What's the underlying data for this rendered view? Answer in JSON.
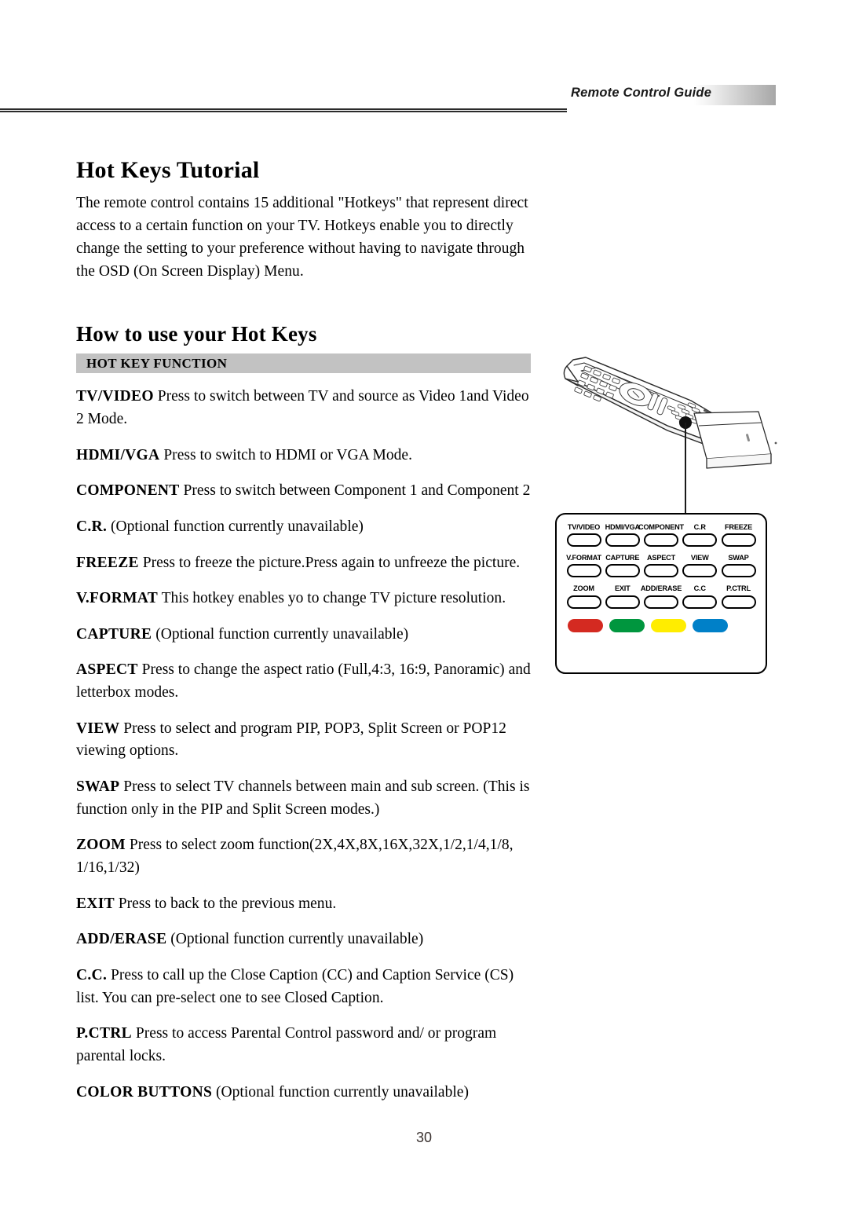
{
  "header": {
    "running_title": "Remote Control Guide"
  },
  "section_one": {
    "title": "Hot Keys Tutorial",
    "intro": "The remote control contains 15 additional \"Hotkeys\" that represent direct access to a certain function on your TV.  Hotkeys enable you to directly change the setting to your preference without having to navigate through the OSD (On Screen Display) Menu."
  },
  "section_two": {
    "title": "How to use your Hot Keys",
    "table_header": "HOT KEY FUNCTION",
    "entries": [
      {
        "key": "TV/VIDEO",
        "desc": "Press to switch between TV and  source as Video 1and Video 2 Mode."
      },
      {
        "key": "HDMI/VGA",
        "desc": "Press to switch to HDMI or VGA Mode."
      },
      {
        "key": "COMPONENT",
        "desc": "Press to switch between Component 1 and Component 2"
      },
      {
        "key": "C.R.",
        "desc": "(Optional function currently unavailable)"
      },
      {
        "key": "FREEZE",
        "desc": "Press to freeze the picture.Press again to unfreeze the  picture."
      },
      {
        "key": "V.FORMAT",
        "desc": "This hotkey enables yo to change TV picture resolution."
      },
      {
        "key": "CAPTURE",
        "desc": "(Optional function currently unavailable)"
      },
      {
        "key": "ASPECT",
        "desc": "Press to change the aspect ratio (Full,4:3, 16:9, Panoramic) and letterbox modes."
      },
      {
        "key": "VIEW",
        "desc": "Press to select and program PIP, POP3, Split Screen or POP12 viewing options."
      },
      {
        "key": "SWAP",
        "desc": "Press to select TV channels between main and sub screen. (This is function only in the PIP and Split Screen modes.)"
      },
      {
        "key": "ZOOM",
        "desc": "Press to select zoom function(2X,4X,8X,16X,32X,1/2,1/4,1/8, 1/16,1/32)"
      },
      {
        "key": "EXIT",
        "desc": "Press to back to the previous menu."
      },
      {
        "key": "ADD/ERASE",
        "desc": "(Optional function currently unavailable)"
      },
      {
        "key": "C.C.",
        "desc": "Press to call up the Close Caption (CC) and Caption Service (CS) list. You can pre-select one to see Closed Caption."
      },
      {
        "key": "P.CTRL",
        "desc": "Press to access Parental Control password and/ or program parental locks."
      },
      {
        "key": "COLOR BUTTONS",
        "desc": "(Optional function currently unavailable)"
      }
    ]
  },
  "remote_figure": {
    "illustration_name": "remote-control-perspective-drawing",
    "callout_name": "hotkey-cluster-callout",
    "button_rows": [
      [
        "TV/VIDEO",
        "HDMI/VGA",
        "COMPONENT",
        "C.R",
        "FREEZE"
      ],
      [
        "V.FORMAT",
        "CAPTURE",
        "ASPECT",
        "VIEW",
        "SWAP"
      ],
      [
        "ZOOM",
        "EXIT",
        "ADD/ERASE",
        "C.C",
        "P.CTRL"
      ]
    ],
    "color_buttons": [
      {
        "name": "red",
        "color": "#d42a21"
      },
      {
        "name": "green",
        "color": "#00963e"
      },
      {
        "name": "yellow",
        "color": "#ffed00"
      },
      {
        "name": "blue",
        "color": "#0080c8"
      }
    ]
  },
  "footer": {
    "page_number": "30"
  }
}
